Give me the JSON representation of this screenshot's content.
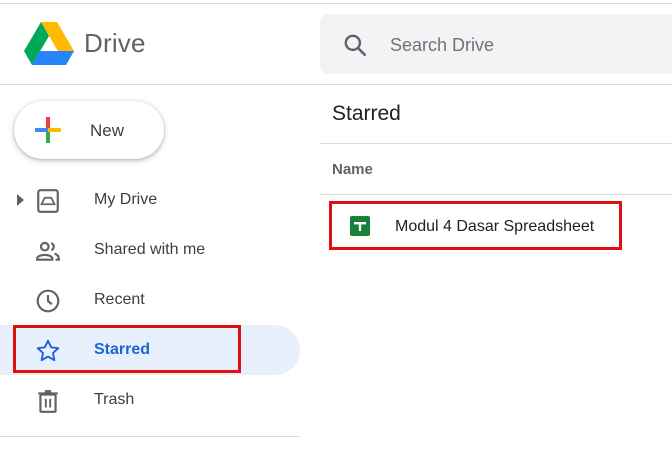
{
  "header": {
    "app_title": "Drive",
    "search_placeholder": "Search Drive",
    "search_icon": "search-icon",
    "logo_icon": "google-drive-logo"
  },
  "sidebar": {
    "new_button_label": "New",
    "new_button_icon": "plus-icon",
    "items": [
      {
        "label": "My Drive",
        "icon": "my-drive-icon",
        "active": false,
        "expandable": true
      },
      {
        "label": "Shared with me",
        "icon": "people-icon",
        "active": false,
        "expandable": false
      },
      {
        "label": "Recent",
        "icon": "clock-icon",
        "active": false,
        "expandable": false
      },
      {
        "label": "Starred",
        "icon": "star-icon",
        "active": true,
        "expandable": false
      },
      {
        "label": "Trash",
        "icon": "trash-icon",
        "active": false,
        "expandable": false
      }
    ]
  },
  "main": {
    "page_title": "Starred",
    "column_header": "Name",
    "files": [
      {
        "name": "Modul 4 Dasar Spreadsheet",
        "icon": "sheets-icon"
      }
    ]
  },
  "colors": {
    "active_bg": "#e8f0fe",
    "active_text": "#1967d2",
    "highlight": "#e01010",
    "sheets_green": "#188038"
  }
}
